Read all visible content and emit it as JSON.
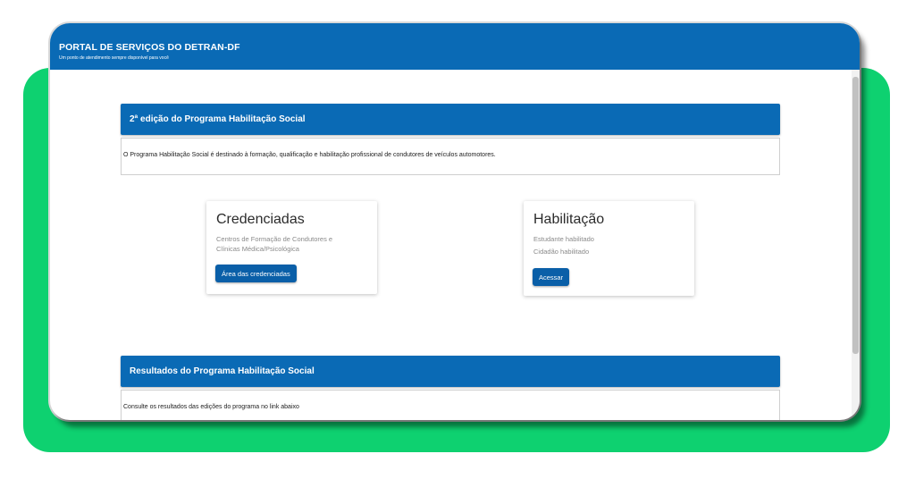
{
  "header": {
    "title": "PORTAL DE SERVIÇOS DO DETRAN-DF",
    "subtitle": "Um ponto de atendimento sempre disponível para você"
  },
  "program_section": {
    "title": "2ª edição do Programa Habilitação Social",
    "description": "O Programa Habilitação Social é destinado à formação, qualificação e habilitação profissional de condutores de veículos automotores."
  },
  "cards": {
    "credenciadas": {
      "title": "Credenciadas",
      "lines": [
        "Centros de Formação de Condutores e",
        "Clínicas Médica/Psicológica"
      ],
      "button": "Área das credenciadas"
    },
    "habilitacao": {
      "title": "Habilitação",
      "lines": [
        "Estudante habilitado",
        "Cidadão habilitado"
      ],
      "button": "Acessar"
    }
  },
  "results_section": {
    "title": "Resultados do Programa Habilitação Social",
    "description": "Consulte os resultados das edições do programa no link abaixo"
  },
  "colors": {
    "brand_blue": "#0a6ab5",
    "background_green": "#0ed170"
  }
}
